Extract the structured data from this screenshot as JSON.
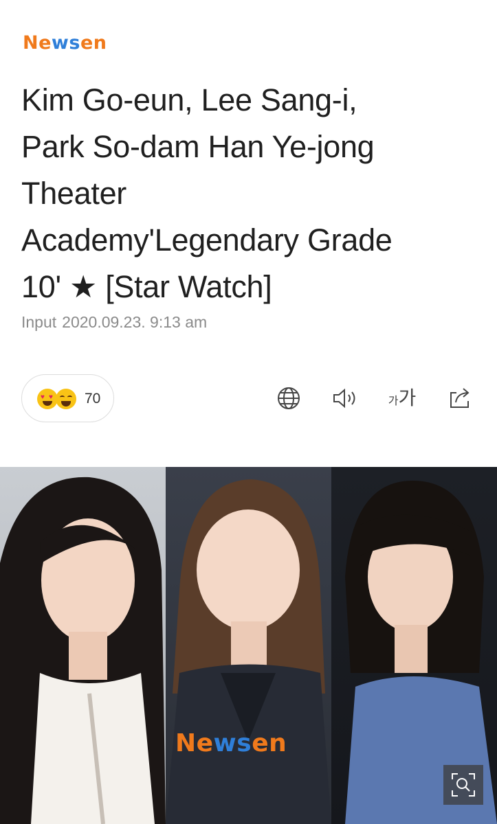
{
  "header": {
    "logo_parts": [
      "Ne",
      "ws",
      "en"
    ]
  },
  "article": {
    "headline_lines": [
      "Kim Go-eun, Lee Sang-i,",
      "Park So-dam Han Ye-jong",
      "Theater",
      "Academy'Legendary Grade",
      "10' ★ [Star Watch]"
    ],
    "date_label": "Input",
    "date_value": "2020.09.23. 9:13 am"
  },
  "reactions": {
    "count": "70",
    "icons": [
      "heart-eyes-emoji",
      "laughing-emoji"
    ]
  },
  "toolbar": {
    "icons": [
      "globe-icon",
      "speaker-icon",
      "font-size-icon",
      "share-icon"
    ],
    "font_small": "가",
    "font_big": "가"
  },
  "photo": {
    "watermark_parts": [
      "Ne",
      "ws",
      "en"
    ],
    "zoom_icon": "zoom-icon"
  },
  "colors": {
    "brand_orange": "#f07a1c",
    "brand_blue": "#2f7fd9",
    "reaction_yellow": "#f9c316"
  }
}
